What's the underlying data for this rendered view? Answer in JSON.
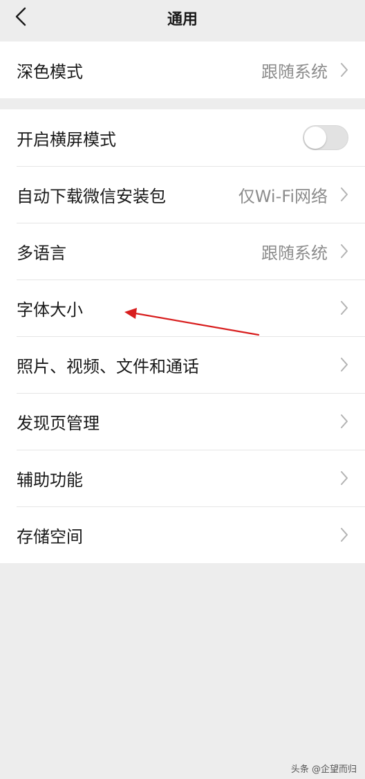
{
  "nav": {
    "title": "通用",
    "back_icon": "chevron-left-icon"
  },
  "group1": {
    "dark_mode": {
      "label": "深色模式",
      "value": "跟随系统"
    }
  },
  "group2": {
    "landscape": {
      "label": "开启横屏模式",
      "enabled": false
    },
    "auto_download": {
      "label": "自动下载微信安装包",
      "value": "仅Wi-Fi网络"
    },
    "language": {
      "label": "多语言",
      "value": "跟随系统"
    },
    "font_size": {
      "label": "字体大小"
    },
    "media": {
      "label": "照片、视频、文件和通话"
    },
    "discover": {
      "label": "发现页管理"
    },
    "accessibility": {
      "label": "辅助功能"
    },
    "storage": {
      "label": "存储空间"
    }
  },
  "annotation": {
    "color": "#d81e1e",
    "points_to": "font_size"
  },
  "watermark": "头条 @企望而归",
  "colors": {
    "background": "#ededed",
    "card": "#ffffff",
    "text": "#191919",
    "secondary": "#8c8c8c",
    "toggle_off": "#e2e2e2"
  }
}
